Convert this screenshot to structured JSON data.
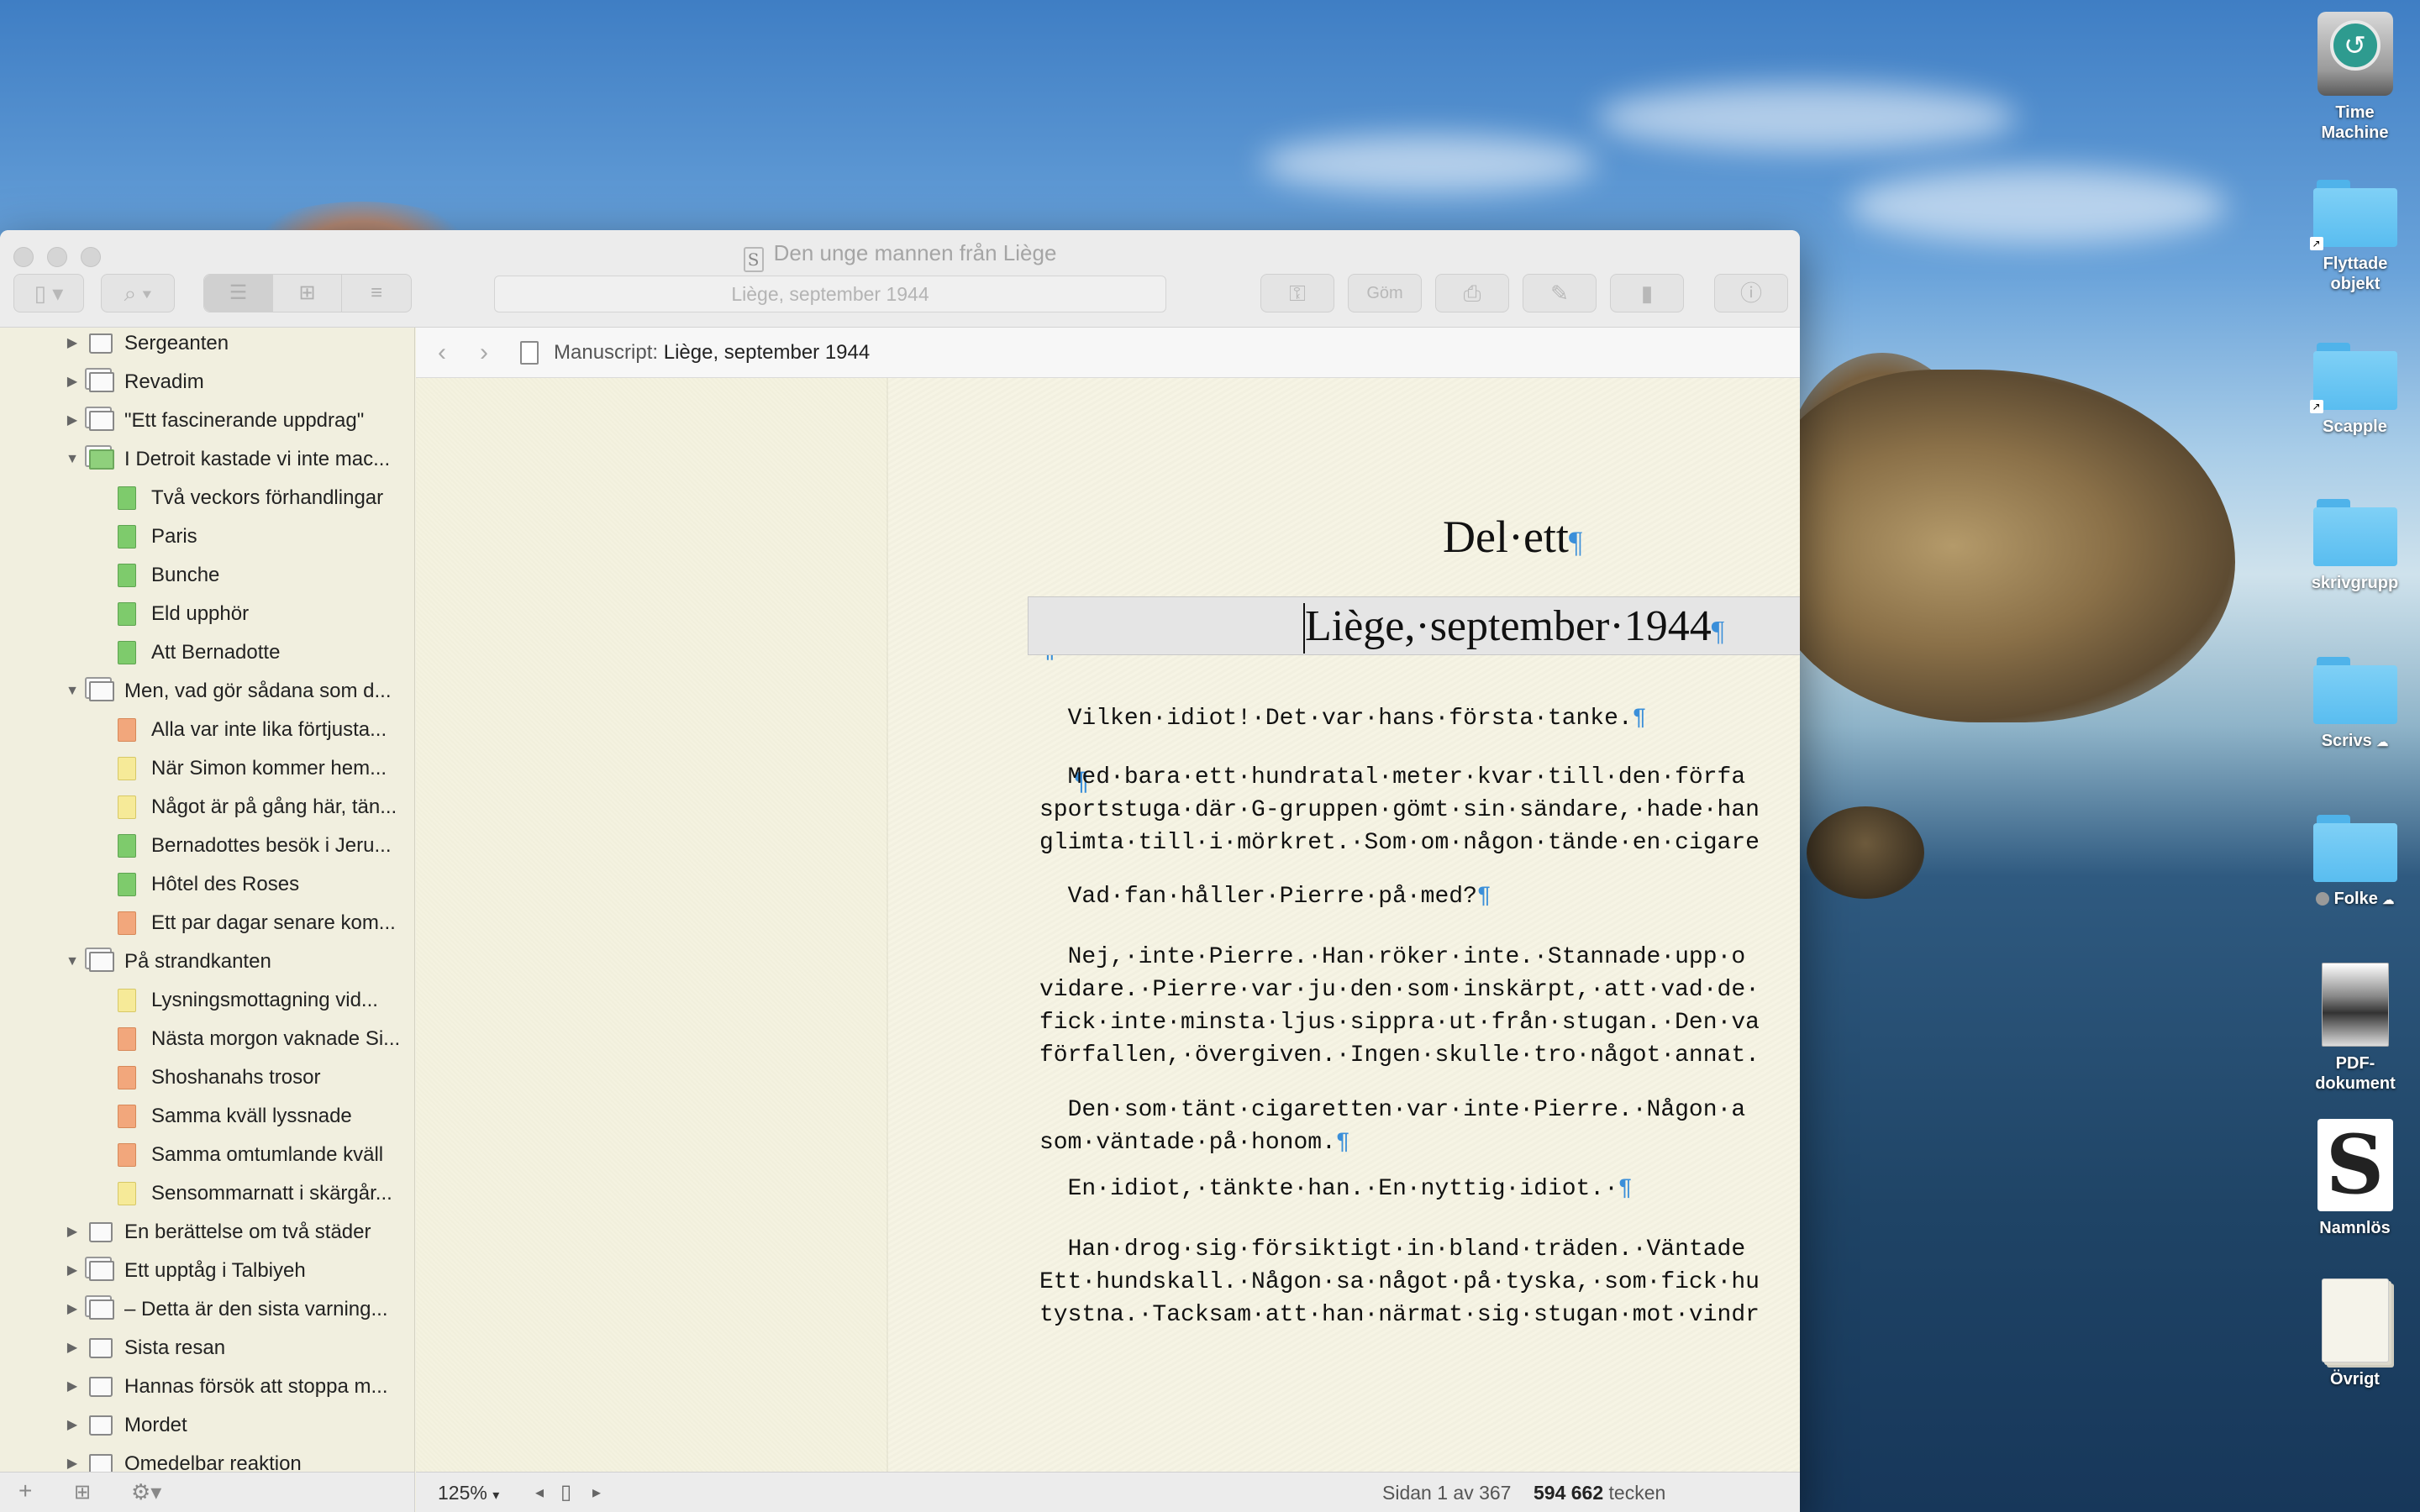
{
  "window": {
    "title": "Den unge mannen från Liège",
    "search_placeholder": "Liège, september 1944",
    "toolbar_hide_label": "Göm"
  },
  "desktop": {
    "icons": [
      {
        "label": "Time Machine"
      },
      {
        "label": "Flyttade objekt"
      },
      {
        "label": "Scapple"
      },
      {
        "label": "skrivgrupp"
      },
      {
        "label": "Scrivs"
      },
      {
        "label": "Folke"
      },
      {
        "label": "PDF-dokument"
      },
      {
        "label": "Namnlös"
      },
      {
        "label": "Övrigt"
      }
    ]
  },
  "binder": {
    "items": [
      {
        "label": "Sergeanten",
        "type": "folder",
        "expand": "closed",
        "level": 0
      },
      {
        "label": "Revadim",
        "type": "stack",
        "expand": "closed",
        "level": 0
      },
      {
        "label": "\"Ett fascinerande uppdrag\"",
        "type": "stack",
        "expand": "closed",
        "level": 0
      },
      {
        "label": "I Detroit kastade vi inte mac...",
        "type": "stack-green",
        "expand": "open",
        "level": 0
      },
      {
        "label": "Två veckors förhandlingar",
        "type": "green",
        "level": 1
      },
      {
        "label": "Paris",
        "type": "green",
        "level": 1
      },
      {
        "label": "Bunche",
        "type": "green",
        "level": 1
      },
      {
        "label": "Eld upphör",
        "type": "green",
        "level": 1
      },
      {
        "label": "Att Bernadotte",
        "type": "green",
        "level": 1
      },
      {
        "label": "Men, vad gör sådana som d...",
        "type": "stack",
        "expand": "open",
        "level": 0
      },
      {
        "label": "Alla var inte lika förtjusta...",
        "type": "orange",
        "level": 1
      },
      {
        "label": "När Simon kommer hem...",
        "type": "yellow",
        "level": 1
      },
      {
        "label": "Något är på gång här, tän...",
        "type": "yellow",
        "level": 1
      },
      {
        "label": "Bernadottes besök i Jeru...",
        "type": "green",
        "level": 1
      },
      {
        "label": "Hôtel des Roses",
        "type": "green",
        "level": 1
      },
      {
        "label": "Ett par dagar senare kom...",
        "type": "orange",
        "level": 1
      },
      {
        "label": "På strandkanten",
        "type": "stack",
        "expand": "open",
        "level": 0
      },
      {
        "label": "Lysningsmottagning vid...",
        "type": "yellow",
        "level": 1
      },
      {
        "label": "Nästa morgon vaknade Si...",
        "type": "orange",
        "level": 1
      },
      {
        "label": "Shoshanahs trosor",
        "type": "orange",
        "level": 1
      },
      {
        "label": " Samma kväll lyssnade",
        "type": "orange",
        "level": 1
      },
      {
        "label": "Samma omtumlande kväll",
        "type": "orange",
        "level": 1
      },
      {
        "label": "Sensommarnatt i skärgår...",
        "type": "yellow",
        "level": 1
      },
      {
        "label": "En berättelse om två städer",
        "type": "folder",
        "expand": "closed",
        "level": 0
      },
      {
        "label": "Ett upptåg i Talbiyeh",
        "type": "stack",
        "expand": "closed",
        "level": 0
      },
      {
        "label": "– Detta är den sista varning...",
        "type": "stack",
        "expand": "closed",
        "level": 0
      },
      {
        "label": "Sista resan",
        "type": "folder",
        "expand": "closed",
        "level": 0
      },
      {
        "label": "Hannas försök att stoppa m...",
        "type": "folder",
        "expand": "closed",
        "level": 0
      },
      {
        "label": "Mordet",
        "type": "folder",
        "expand": "closed",
        "level": 0
      },
      {
        "label": "Omedelbar reaktion",
        "type": "folder",
        "expand": "closed",
        "level": 0
      }
    ]
  },
  "editor": {
    "header_label": "Manuscript:",
    "header_doc": "Liège, september 1944",
    "part_title": "Del·ett",
    "heading": "Liège,·september·1944",
    "pilcrow": "¶",
    "paragraphs": [
      {
        "text": "  Vilken·idiot!·Det·var·hans·första·tanke.",
        "end": "¶"
      },
      {
        "text": "  Med·bara·ett·hundratal·meter·kvar·till·den·förfa\nsportstuga·där·G-gruppen·gömt·sin·sändare,·hade·han\nglimta·till·i·mörkret.·Som·om·någon·tände·en·cigare",
        "end": ""
      },
      {
        "text": "  Vad·fan·håller·Pierre·på·med?",
        "end": "¶"
      },
      {
        "text": "  Nej,·inte·Pierre.·Han·röker·inte.·Stannade·upp·o\nvidare.·Pierre·var·ju·den·som·inskärpt,·att·vad·de·\nfick·inte·minsta·ljus·sippra·ut·från·stugan.·Den·va\nförfallen,·övergiven.·Ingen·skulle·tro·något·annat.",
        "end": ""
      },
      {
        "text": "  Den·som·tänt·cigaretten·var·inte·Pierre.·Någon·a\nsom·väntade·på·honom.",
        "end": "¶"
      },
      {
        "text": "  En·idiot,·tänkte·han.·En·nyttig·idiot.·",
        "end": "¶"
      },
      {
        "text": "  Han·drog·sig·försiktigt·in·bland·träden.·Väntade\nEtt·hundskall.·Någon·sa·något·på·tyska,·som·fick·hu\ntystna.·Tacksam·att·han·närmat·sig·stugan·mot·vindr",
        "end": ""
      }
    ]
  },
  "statusbar": {
    "zoom": "125%",
    "pages": "Sidan 1 av 367",
    "count_value": "594 662",
    "count_unit": "tecken"
  },
  "colors": {
    "pilcrow": "#3b8fd9",
    "label_green": "#7ecb6c",
    "label_orange": "#f2a77c",
    "label_yellow": "#f6ea98"
  }
}
